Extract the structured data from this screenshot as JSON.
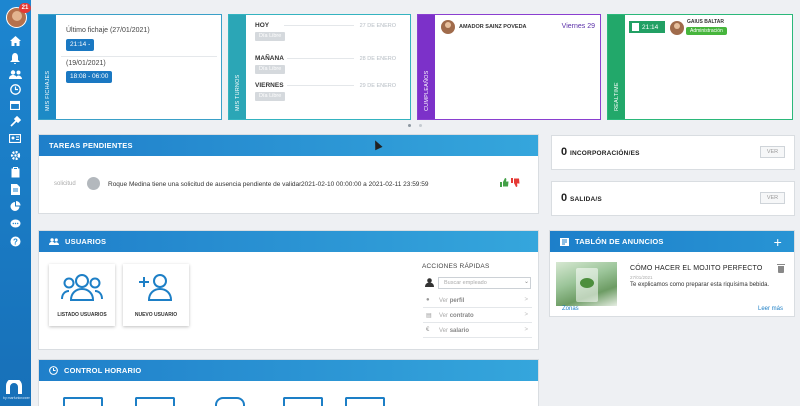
{
  "sidebar": {
    "notification_count": "21",
    "icons": [
      "home-icon",
      "bell-icon",
      "users-icon",
      "clock-icon",
      "calendar-icon",
      "tools-icon",
      "id-card-icon",
      "gear-icon",
      "clipboard-icon",
      "document-icon",
      "pie-chart-icon",
      "chat-icon",
      "help-icon"
    ],
    "brand_text": "by marfunknower"
  },
  "fichajes": {
    "side_label": "MIS FICHAJES",
    "entries": [
      {
        "label": "Último fichaje (27/01/2021)",
        "time": "21:14 -"
      },
      {
        "label": "(19/01/2021)",
        "time": "18:08 - 06:00"
      }
    ]
  },
  "turnos": {
    "side_label": "MIS TURNOS",
    "days": [
      {
        "label": "HOY",
        "date": "27 DE ENERO",
        "chip": "Día Libre"
      },
      {
        "label": "MAÑANA",
        "date": "28 DE ENERO",
        "chip": "Día Libre"
      },
      {
        "label": "VIERNES",
        "date": "29 DE ENERO",
        "chip": "Día Libre"
      }
    ]
  },
  "cumpleanos": {
    "side_label": "CUMPLEAÑOS",
    "name": "AMADOR SAINZ POVEDA",
    "day": "Viernes 29"
  },
  "realtime": {
    "side_label": "REALTIME",
    "time": "21:14",
    "name": "GAIUS BALTAR",
    "role": "Administración"
  },
  "tareas": {
    "title": "TAREAS PENDIENTES",
    "row": {
      "type": "solicitud",
      "text": "Roque Medina tiene una solicitud de ausencia pendiente de validar",
      "range": "2021-02-10 00:00:00 a 2021-02-11 23:59:59"
    }
  },
  "incorporaciones": {
    "count": "0",
    "label": "INCORPORACIÓN/ES",
    "button": "VER"
  },
  "salidas": {
    "count": "0",
    "label": "SALIDA/S",
    "button": "VER"
  },
  "usuarios": {
    "title": "USUARIOS",
    "tiles": [
      "LISTADO USUARIOS",
      "NUEVO USUARIO"
    ],
    "quick_title": "ACCIONES RÁPIDAS",
    "search_placeholder": "Buscar empleado",
    "links": [
      {
        "prefix": "Ver",
        "bold": "perfil"
      },
      {
        "prefix": "Ver",
        "bold": "contrato"
      },
      {
        "prefix": "Ver",
        "bold": "salario"
      }
    ]
  },
  "control": {
    "title": "CONTROL HORARIO"
  },
  "anuncios": {
    "title": "TABLÓN DE ANUNCIOS",
    "post_title": "CÓMO HACER EL MOJITO PERFECTO",
    "post_date": "27/01/2021",
    "post_body": "Te explicamos como preparar esta riquísima bebida.",
    "zone_link": "Zonas",
    "more_link": "Leer más"
  },
  "colors": {
    "primary": "#1d86d0",
    "fichajes": "#1d8ac6",
    "turnos": "#2ba6b6",
    "cumple": "#7c31c9",
    "realtime": "#22a86a"
  }
}
